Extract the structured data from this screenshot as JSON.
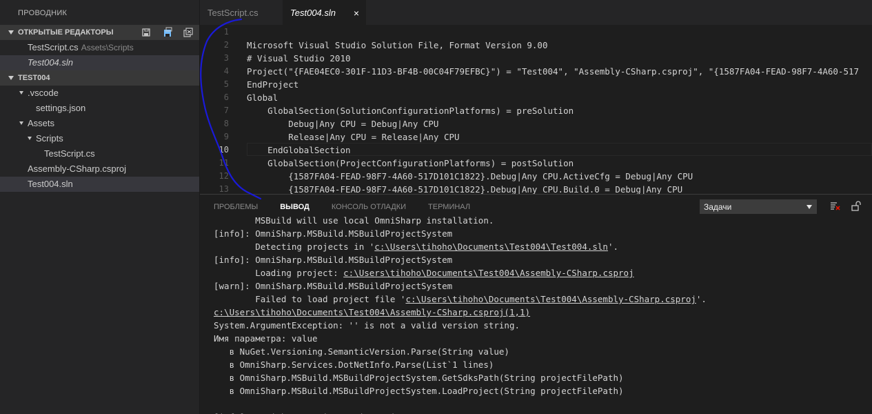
{
  "sidebar": {
    "title": "ПРОВОДНИК",
    "open_editors": {
      "header": "ОТКРЫТЫЕ РЕДАКТОРЫ",
      "items": [
        {
          "name": "TestScript.cs",
          "meta": "Assets\\Scripts"
        },
        {
          "name": "Test004.sln",
          "meta": ""
        }
      ]
    },
    "workspace": {
      "header": "TEST004",
      "items": [
        {
          "label": ".vscode"
        },
        {
          "label": "settings.json"
        },
        {
          "label": "Assets"
        },
        {
          "label": "Scripts"
        },
        {
          "label": "TestScript.cs"
        },
        {
          "label": "Assembly-CSharp.csproj"
        },
        {
          "label": "Test004.sln"
        }
      ]
    }
  },
  "tabs": [
    {
      "label": "TestScript.cs"
    },
    {
      "label": "Test004.sln",
      "close": "×"
    }
  ],
  "editor": {
    "lines": [
      {
        "n": "1",
        "text": ""
      },
      {
        "n": "2",
        "text": "Microsoft Visual Studio Solution File, Format Version 9.00"
      },
      {
        "n": "3",
        "text": "# Visual Studio 2010"
      },
      {
        "n": "4",
        "text": "Project(\"{FAE04EC0-301F-11D3-BF4B-00C04F79EFBC}\") = \"Test004\", \"Assembly-CSharp.csproj\", \"{1587FA04-FEAD-98F7-4A60-517"
      },
      {
        "n": "5",
        "text": "EndProject"
      },
      {
        "n": "6",
        "text": "Global"
      },
      {
        "n": "7",
        "text": "    GlobalSection(SolutionConfigurationPlatforms) = preSolution"
      },
      {
        "n": "8",
        "text": "        Debug|Any CPU = Debug|Any CPU"
      },
      {
        "n": "9",
        "text": "        Release|Any CPU = Release|Any CPU"
      },
      {
        "n": "10",
        "text": "    EndGlobalSection"
      },
      {
        "n": "11",
        "text": "    GlobalSection(ProjectConfigurationPlatforms) = postSolution"
      },
      {
        "n": "12",
        "text": "        {1587FA04-FEAD-98F7-4A60-517D101C1822}.Debug|Any CPU.ActiveCfg = Debug|Any CPU"
      },
      {
        "n": "13",
        "text": "        {1587FA04-FEAD-98F7-4A60-517D101C1822}.Debug|Any CPU.Build.0 = Debug|Any CPU"
      }
    ]
  },
  "panel": {
    "tabs": [
      "ПРОБЛЕМЫ",
      "ВЫВОД",
      "КОНСОЛЬ ОТЛАДКИ",
      "ТЕРМИНАЛ"
    ],
    "select_value": "Задачи",
    "output": [
      [
        {
          "t": "        MSBuild will use local OmniSharp installation."
        }
      ],
      [
        {
          "t": "[info]: OmniSharp.MSBuild.MSBuildProjectSystem"
        }
      ],
      [
        {
          "t": "        Detecting projects in '"
        },
        {
          "t": "c:\\Users\\tihoho\\Documents\\Test004\\Test004.sln",
          "link": true
        },
        {
          "t": "'."
        }
      ],
      [
        {
          "t": "[info]: OmniSharp.MSBuild.MSBuildProjectSystem"
        }
      ],
      [
        {
          "t": "        Loading project: "
        },
        {
          "t": "c:\\Users\\tihoho\\Documents\\Test004\\Assembly-CSharp.csproj",
          "link": true
        }
      ],
      [
        {
          "t": "[warn]: OmniSharp.MSBuild.MSBuildProjectSystem"
        }
      ],
      [
        {
          "t": "        Failed to load project file '"
        },
        {
          "t": "c:\\Users\\tihoho\\Documents\\Test004\\Assembly-CSharp.csproj",
          "link": true
        },
        {
          "t": "'."
        }
      ],
      [
        {
          "t": "c:\\Users\\tihoho\\Documents\\Test004\\Assembly-CSharp.csproj(1,1)",
          "link": true
        }
      ],
      [
        {
          "t": "System.ArgumentException: '' is not a valid version string."
        }
      ],
      [
        {
          "t": "Имя параметра: value"
        }
      ],
      [
        {
          "t": "   в NuGet.Versioning.SemanticVersion.Parse(String value)"
        }
      ],
      [
        {
          "t": "   в OmniSharp.Services.DotNetInfo.Parse(List`1 lines)"
        }
      ],
      [
        {
          "t": "   в OmniSharp.MSBuild.MSBuildProjectSystem.GetSdksPath(String projectFilePath)"
        }
      ],
      [
        {
          "t": "   в OmniSharp.MSBuild.MSBuildProjectSystem.LoadProject(String projectFilePath)"
        }
      ],
      [
        {
          "t": ""
        }
      ],
      [
        {
          "t": "[info]: OmniSharp.Script.ScriptProjectSystem"
        }
      ]
    ]
  },
  "colors": {
    "sidebar_bg": "#252526",
    "editor_bg": "#1e1e1e",
    "section_header_bg": "#383838",
    "annotation_ink": "#1a1ad8"
  }
}
